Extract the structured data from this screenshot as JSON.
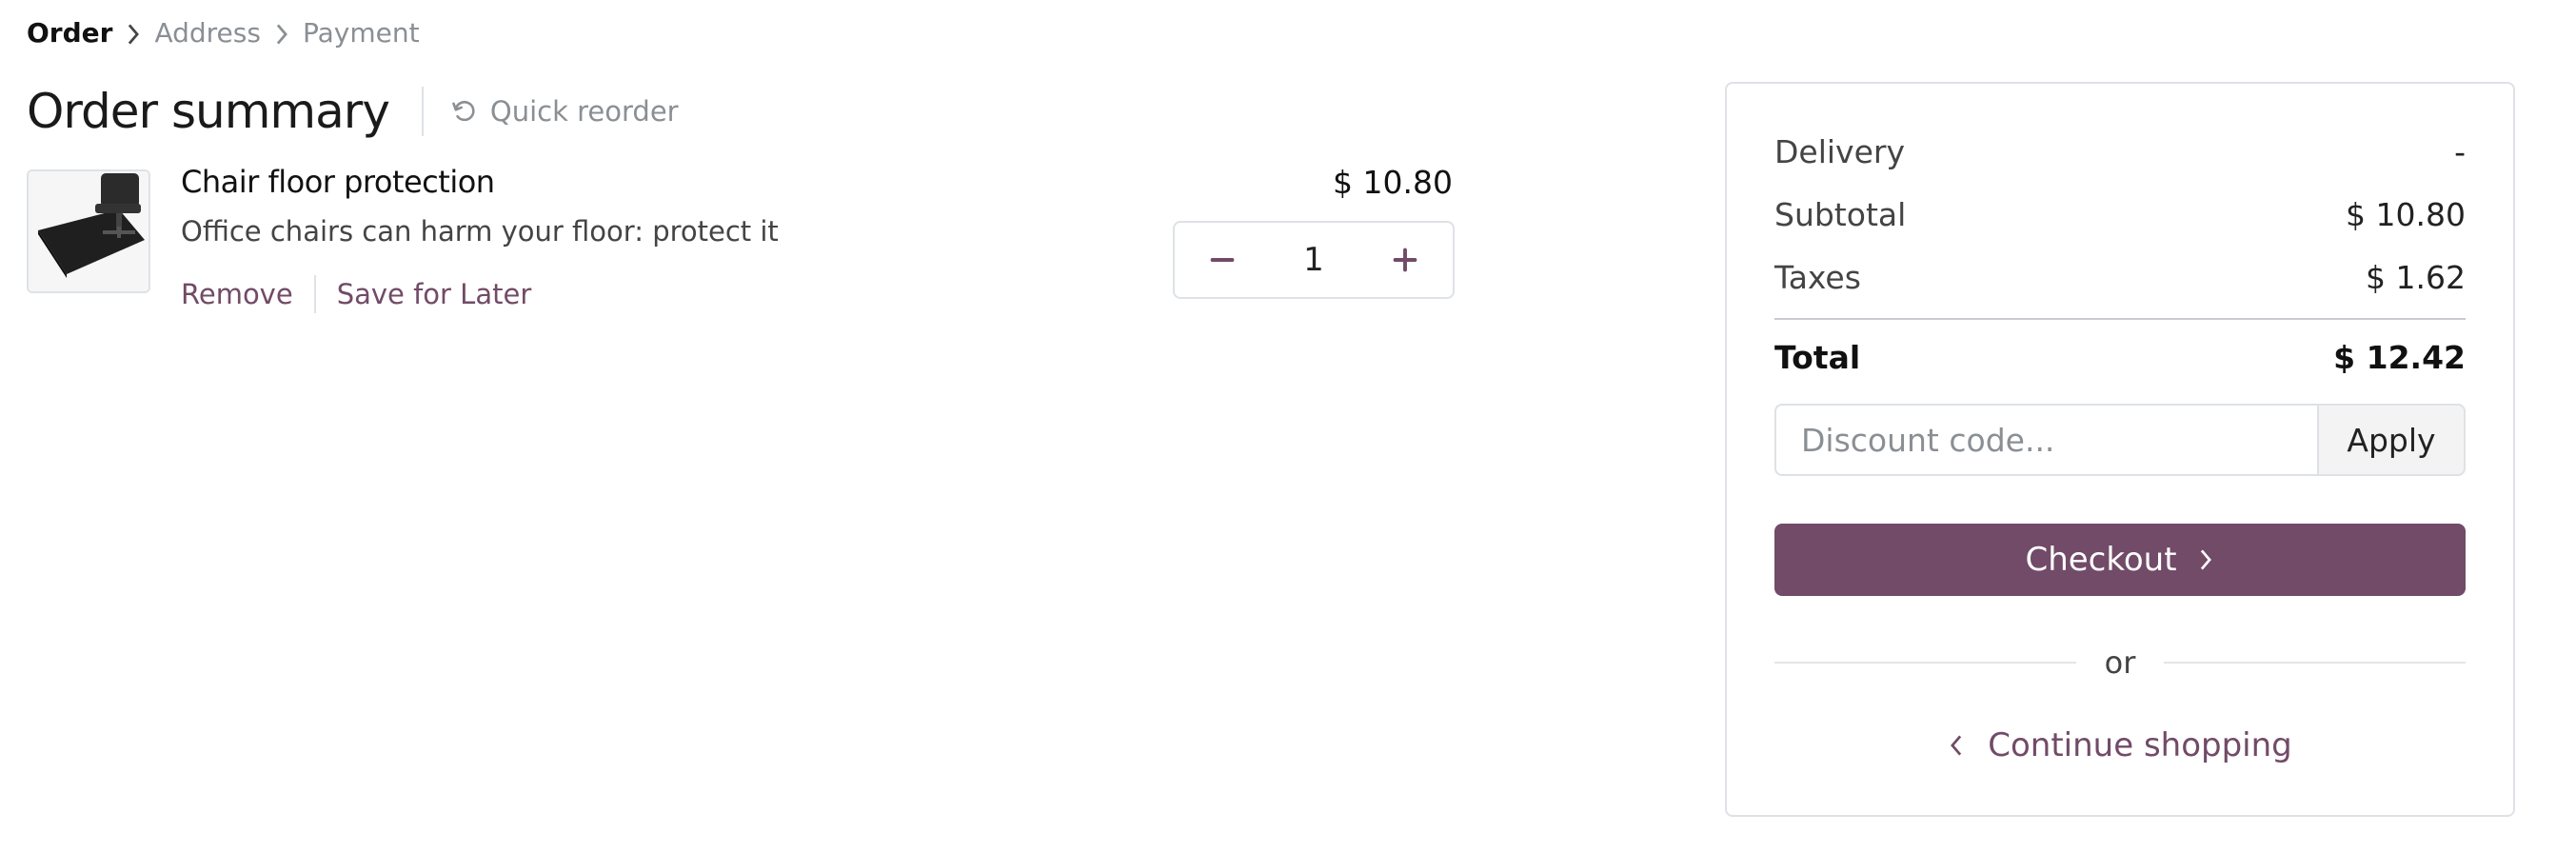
{
  "breadcrumb": {
    "steps": [
      "Order",
      "Address",
      "Payment"
    ]
  },
  "header": {
    "title": "Order summary",
    "quick_reorder_label": "Quick reorder"
  },
  "cart": {
    "items": [
      {
        "name": "Chair floor protection",
        "description": "Office chairs can harm your floor: protect it",
        "price": "$ 10.80",
        "quantity": "1",
        "remove_label": "Remove",
        "save_later_label": "Save for Later",
        "image_icon": "chair-mat-image"
      }
    ]
  },
  "summary": {
    "delivery_label": "Delivery",
    "delivery_value": "-",
    "subtotal_label": "Subtotal",
    "subtotal_value": "$ 10.80",
    "taxes_label": "Taxes",
    "taxes_value": "$ 1.62",
    "total_label": "Total",
    "total_value": "$ 12.42",
    "discount_placeholder": "Discount code...",
    "apply_label": "Apply",
    "checkout_label": "Checkout",
    "or_label": "or",
    "continue_label": "Continue shopping"
  },
  "colors": {
    "accent": "#714b67",
    "muted": "#8a8f94",
    "border": "#dee2e6"
  }
}
